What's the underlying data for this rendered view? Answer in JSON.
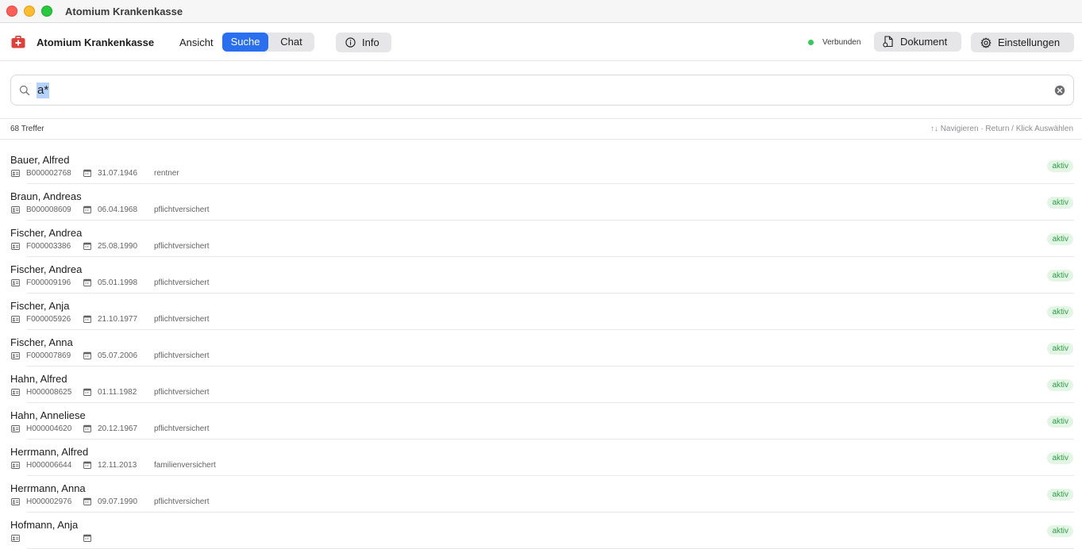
{
  "window": {
    "title": "Atomium Krankenkasse"
  },
  "toolbar": {
    "app_name": "Atomium Krankenkasse",
    "view_label": "Ansicht",
    "segments": [
      {
        "label": "Suche",
        "active": true
      },
      {
        "label": "Chat",
        "active": false
      }
    ],
    "info_label": "Info",
    "status": "Verbunden",
    "status_color": "#34c759",
    "document_label": "Dokument",
    "settings_label": "Einstellungen",
    "accent_color": "#2a6ff0"
  },
  "search": {
    "value": "a*",
    "selected_text": "a*",
    "placeholder": ""
  },
  "results": {
    "count_label": "68 Treffer",
    "hint": "↑↓ Navigieren · Return / Klick Auswählen",
    "rows": [
      {
        "name": "Bauer, Alfred",
        "id": "B000002768",
        "date": "31.07.1946",
        "type": "rentner",
        "status": "aktiv"
      },
      {
        "name": "Braun, Andreas",
        "id": "B000008609",
        "date": "06.04.1968",
        "type": "pflichtversichert",
        "status": "aktiv"
      },
      {
        "name": "Fischer, Andrea",
        "id": "F000003386",
        "date": "25.08.1990",
        "type": "pflichtversichert",
        "status": "aktiv"
      },
      {
        "name": "Fischer, Andrea",
        "id": "F000009196",
        "date": "05.01.1998",
        "type": "pflichtversichert",
        "status": "aktiv"
      },
      {
        "name": "Fischer, Anja",
        "id": "F000005926",
        "date": "21.10.1977",
        "type": "pflichtversichert",
        "status": "aktiv"
      },
      {
        "name": "Fischer, Anna",
        "id": "F000007869",
        "date": "05.07.2006",
        "type": "pflichtversichert",
        "status": "aktiv"
      },
      {
        "name": "Hahn, Alfred",
        "id": "H000008625",
        "date": "01.11.1982",
        "type": "pflichtversichert",
        "status": "aktiv"
      },
      {
        "name": "Hahn, Anneliese",
        "id": "H000004620",
        "date": "20.12.1967",
        "type": "pflichtversichert",
        "status": "aktiv"
      },
      {
        "name": "Herrmann, Alfred",
        "id": "H000006644",
        "date": "12.11.2013",
        "type": "familienversichert",
        "status": "aktiv"
      },
      {
        "name": "Herrmann, Anna",
        "id": "H000002976",
        "date": "09.07.1990",
        "type": "pflichtversichert",
        "status": "aktiv"
      },
      {
        "name": "Hofmann, Anja",
        "id": "",
        "date": "",
        "type": "",
        "status": "aktiv"
      }
    ]
  }
}
